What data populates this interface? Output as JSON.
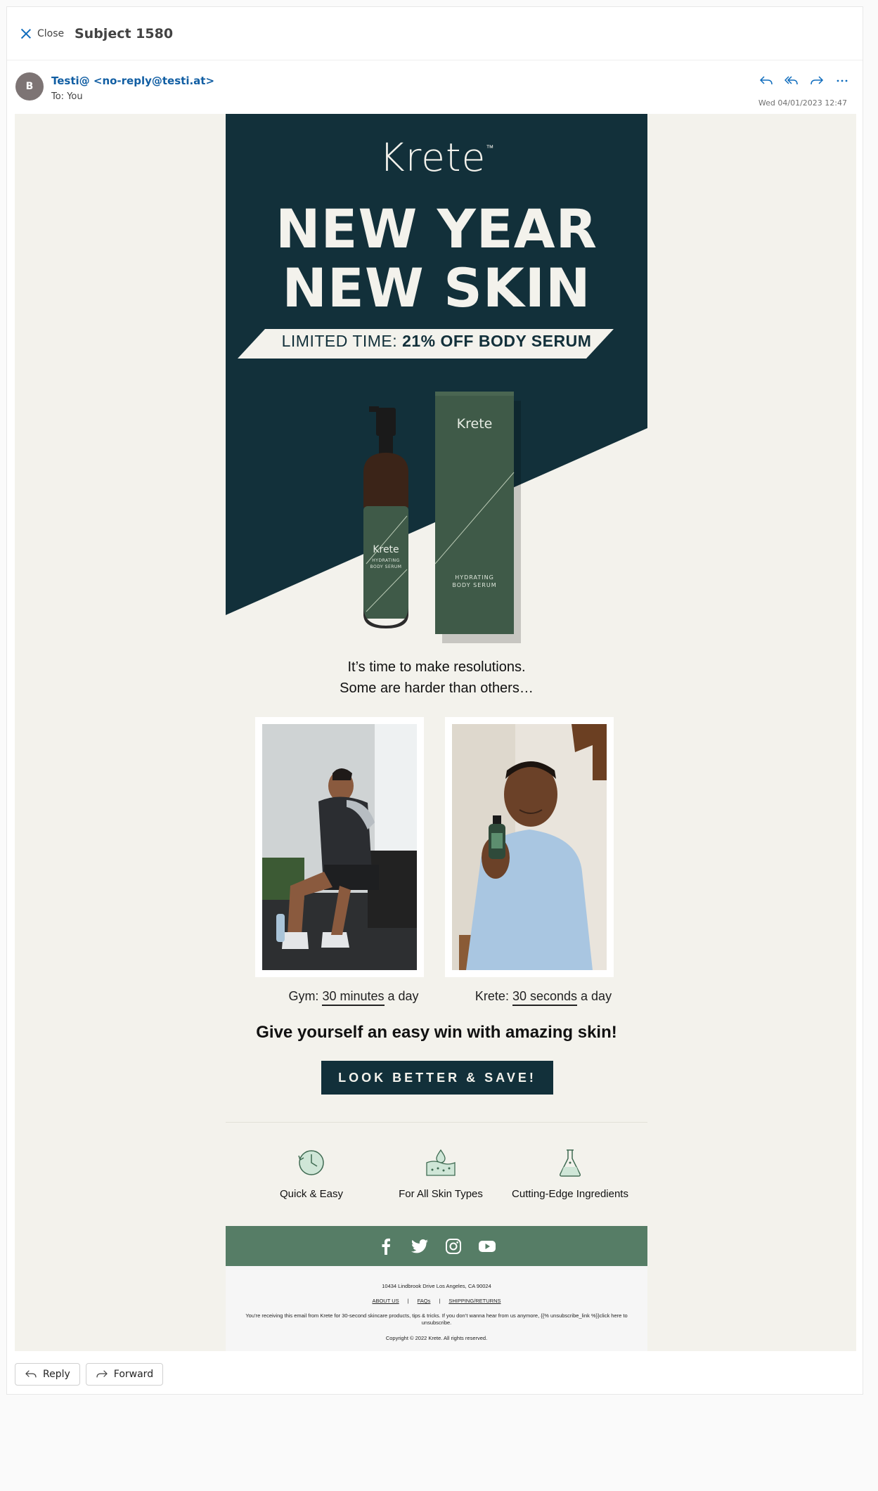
{
  "header": {
    "close_label": "Close",
    "subject": "Subject 1580"
  },
  "message": {
    "avatar_initial": "B",
    "from": "Testi@ <no-reply@testi.at>",
    "to": "To:  You",
    "date": "Wed 04/01/2023 12:47",
    "actions": [
      "reply-icon",
      "reply-all-icon",
      "forward-icon",
      "more-icon"
    ]
  },
  "email": {
    "brand": "Krete",
    "brand_tm": "™",
    "headline_1": "NEW YEAR",
    "headline_2": "NEW SKIN",
    "offer_prefix": "LIMITED TIME: ",
    "offer_bold": "21% OFF BODY SERUM",
    "product": {
      "bottle_brand": "Krete",
      "bottle_label_1": "HYDRATING",
      "bottle_label_2": "BODY SERUM",
      "box_brand": "Krete",
      "box_label_1": "HYDRATING",
      "box_label_2": "BODY SERUM"
    },
    "intro_1": "It’s time to make resolutions.",
    "intro_2": "Some are harder than others…",
    "captions": [
      {
        "prefix": "Gym: ",
        "emph": "30 minutes",
        "suffix": " a day"
      },
      {
        "prefix": "Krete: ",
        "emph": "30 seconds",
        "suffix": " a day"
      }
    ],
    "cta_headline": "Give yourself an easy win with amazing skin!",
    "cta_button": "LOOK BETTER & SAVE!",
    "features": [
      {
        "icon": "clock-icon",
        "label": "Quick & Easy"
      },
      {
        "icon": "skin-drop-icon",
        "label": "For All Skin Types"
      },
      {
        "icon": "flask-icon",
        "label": "Cutting-Edge Ingredients"
      }
    ],
    "social": [
      "facebook-icon",
      "twitter-icon",
      "instagram-icon",
      "youtube-icon"
    ],
    "footer": {
      "address": "10434 Lindbrook Drive Los Angeles, CA 90024",
      "link_about": "ABOUT US",
      "link_faqs": "FAQs",
      "link_shipping": "SHIPPING/RETURNS",
      "notice": "You’re receiving this email from Krete for 30-second skincare products, tips & tricks. If you don’t wanna hear from us anymore, {{% unsubscribe_link %}}click here to unsubscribe.",
      "copyright": "Copyright © 2022 Krete. All rights reserved."
    },
    "colors": {
      "hero_dark": "#12303a",
      "cream": "#f3f2ec",
      "green": "#567d66",
      "product_green": "#3f5a48"
    }
  },
  "bottom_actions": {
    "reply": "Reply",
    "forward": "Forward"
  }
}
